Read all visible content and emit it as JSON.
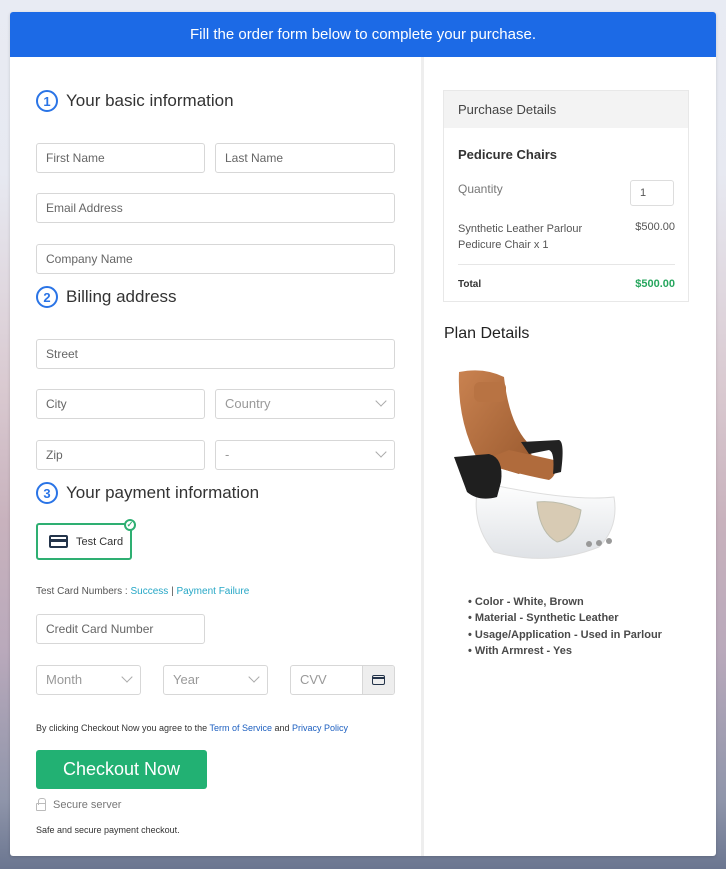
{
  "banner": {
    "text": "Fill the order form below to complete your purchase."
  },
  "sections": {
    "basic": {
      "step": "1",
      "title": "Your basic information"
    },
    "billing": {
      "step": "2",
      "title": "Billing address"
    },
    "payment": {
      "step": "3",
      "title": "Your payment information"
    }
  },
  "fields": {
    "first_name": "First Name",
    "last_name": "Last Name",
    "email": "Email Address",
    "company": "Company Name",
    "street": "Street",
    "city": "City",
    "country": "Country",
    "zip": "Zip",
    "state": "-",
    "card_number": "Credit Card Number",
    "month": "Month",
    "year": "Year",
    "cvv": "CVV"
  },
  "payment": {
    "method_label": "Test Card",
    "test_numbers_label": "Test Card Numbers :",
    "success_link": "Success",
    "separator": "|",
    "failure_link": "Payment Failure"
  },
  "checkout": {
    "terms_prefix": "By clicking Checkout Now you agree to the",
    "terms_link": "Term of Service",
    "and": "and",
    "privacy_link": "Privacy Policy",
    "button": "Checkout Now",
    "secure": "Secure server",
    "safe": "Safe and secure payment checkout."
  },
  "purchase": {
    "header": "Purchase Details",
    "product": "Pedicure Chairs",
    "quantity_label": "Quantity",
    "quantity": "1",
    "item": "Synthetic Leather Parlour Pedicure Chair x 1",
    "item_price": "$500.00",
    "total_label": "Total",
    "total": "$500.00"
  },
  "plan": {
    "title": "Plan Details",
    "features": [
      "Color - White, Brown",
      "Material - Synthetic Leather",
      "Usage/Application - Used in Parlour",
      "With Armrest - Yes"
    ]
  },
  "colors": {
    "brand_blue": "#1c6ae6",
    "accent_green": "#22b173",
    "total_green": "#27a65e",
    "link_teal": "#26a7c6"
  }
}
